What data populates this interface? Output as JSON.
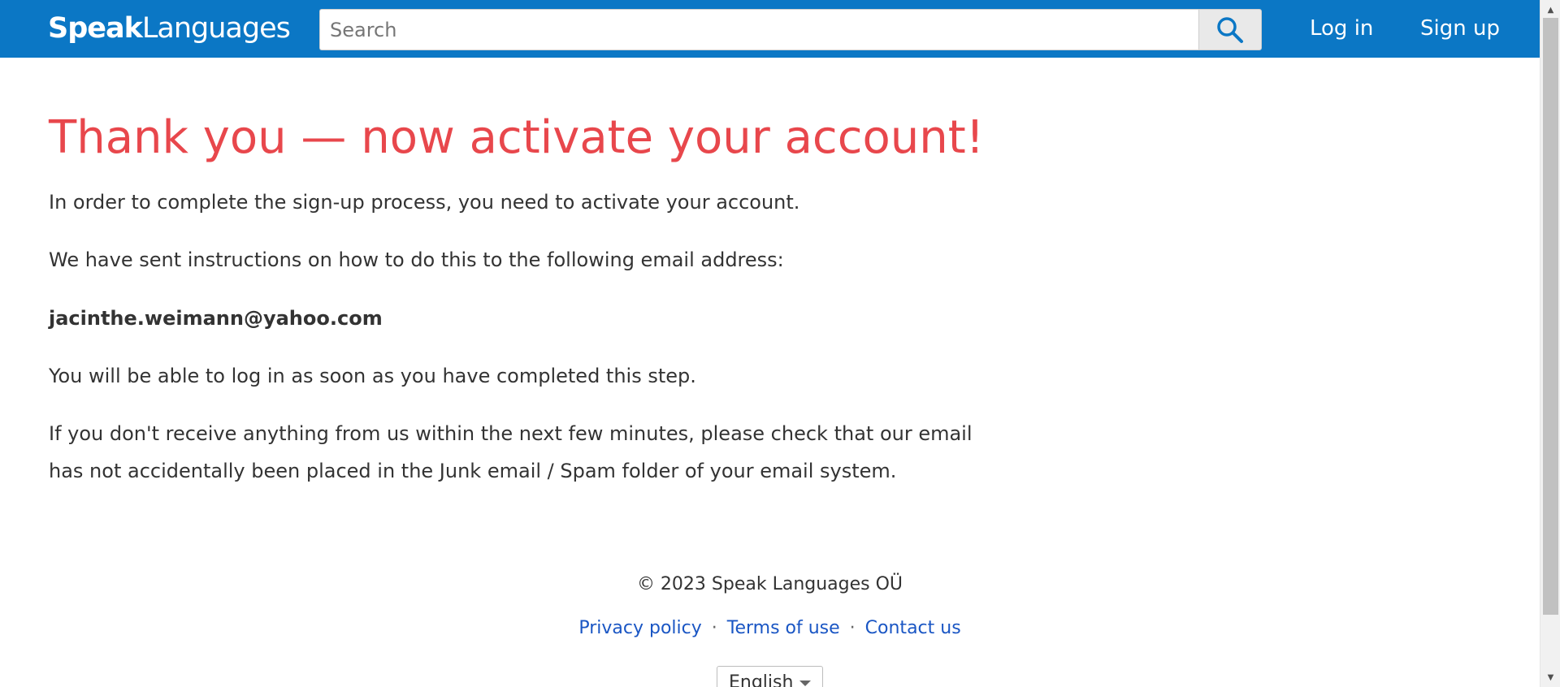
{
  "header": {
    "logo": {
      "bold": "Speak",
      "light": "Languages"
    },
    "search": {
      "placeholder": "Search",
      "value": ""
    },
    "search_icon": "search-icon",
    "login_label": "Log in",
    "signup_label": "Sign up",
    "bar_color": "#0b77c5"
  },
  "main": {
    "title": "Thank you — now activate your account!",
    "paragraph1": "In order to complete the sign-up process, you need to activate your account.",
    "paragraph2": "We have sent instructions on how to do this to the following email address:",
    "email": "jacinthe.weimann@yahoo.com",
    "paragraph3": "You will be able to log in as soon as you have completed this step.",
    "paragraph4": "If you don't receive anything from us within the next few minutes, please check that our email has not accidentally been placed in the Junk email / Spam folder of your email system.",
    "title_color": "#e8474c"
  },
  "footer": {
    "copyright": "© 2023 Speak Languages OÜ",
    "links": [
      "Privacy policy",
      "Terms of use",
      "Contact us"
    ],
    "separator": "·",
    "language_selected": "English",
    "link_color": "#1a56c4"
  }
}
